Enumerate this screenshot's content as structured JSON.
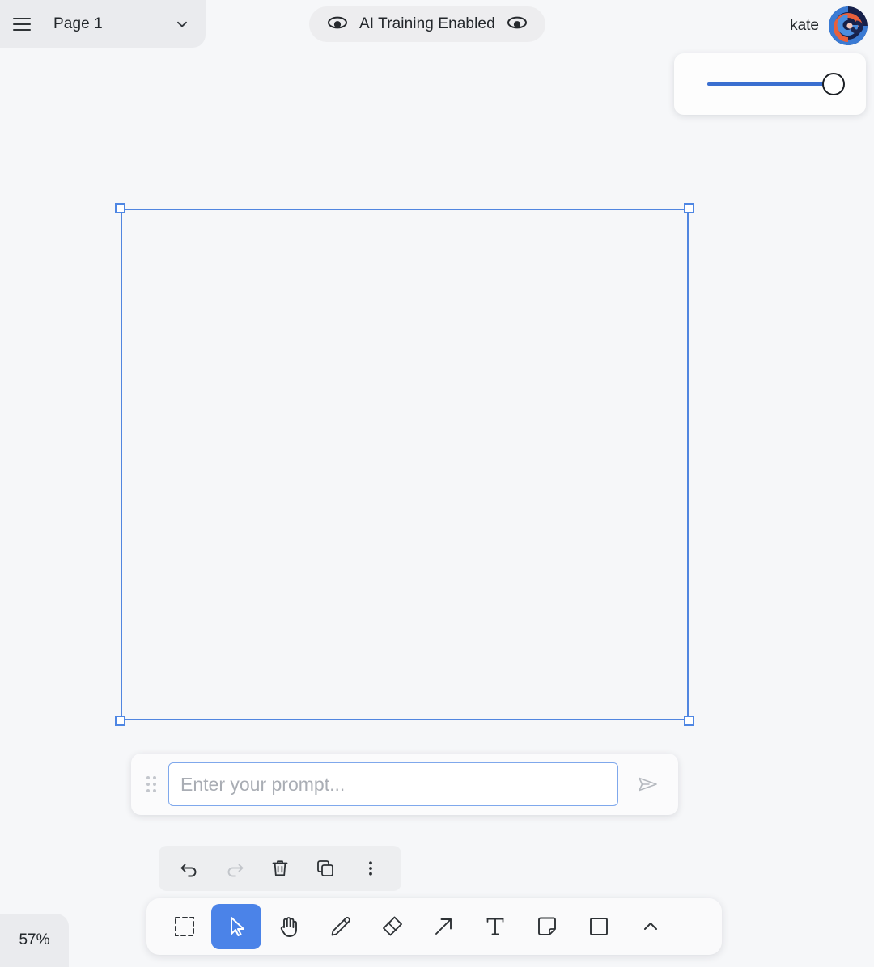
{
  "topbar": {
    "menu_icon": "hamburger-menu-icon",
    "page_label": "Page 1",
    "page_dropdown_icon": "chevron-down-icon"
  },
  "ai_pill": {
    "label": "AI Training Enabled",
    "left_icon": "eye-icon",
    "right_icon": "eye-icon"
  },
  "user": {
    "name": "kate",
    "avatar_icon": "avatar-swirl-icon",
    "avatar_colors": [
      "#1b2550",
      "#3b7bd4",
      "#e8603c",
      "#f3c8bd"
    ]
  },
  "slider": {
    "accent_color": "#3a6fd0",
    "thumb_border_color": "#1b1f24",
    "value_percent": 100
  },
  "selection": {
    "stroke_color": "#5186e0",
    "handle_fill": "#ffffff",
    "handles": [
      "top-left",
      "top-right",
      "bottom-left",
      "bottom-right"
    ]
  },
  "prompt": {
    "drag_handle_icon": "drag-dots-icon",
    "placeholder": "Enter your prompt...",
    "value": "",
    "send_icon": "send-paper-plane-icon",
    "border_color": "#7fa8ec"
  },
  "context_toolbar": {
    "buttons": [
      {
        "name": "undo",
        "icon": "undo-arrow-icon",
        "enabled": true
      },
      {
        "name": "redo",
        "icon": "redo-arrow-icon",
        "enabled": false
      },
      {
        "name": "delete",
        "icon": "trash-icon",
        "enabled": true
      },
      {
        "name": "duplicate",
        "icon": "duplicate-squares-icon",
        "enabled": true
      },
      {
        "name": "more",
        "icon": "more-vertical-dots-icon",
        "enabled": true
      }
    ]
  },
  "tool_dock": {
    "active_tool": "select-cursor",
    "active_color": "#4b83e8",
    "tools": [
      {
        "name": "marquee-select",
        "icon": "dashed-square-icon"
      },
      {
        "name": "select-cursor",
        "icon": "cursor-arrow-icon"
      },
      {
        "name": "pan-hand",
        "icon": "hand-icon"
      },
      {
        "name": "draw-pencil",
        "icon": "pencil-icon"
      },
      {
        "name": "eraser",
        "icon": "eraser-icon"
      },
      {
        "name": "arrow",
        "icon": "arrow-up-right-icon"
      },
      {
        "name": "text",
        "icon": "text-t-icon"
      },
      {
        "name": "sticky-note",
        "icon": "sticky-note-icon"
      },
      {
        "name": "rectangle",
        "icon": "square-icon"
      },
      {
        "name": "collapse",
        "icon": "chevron-up-icon"
      }
    ]
  },
  "zoom": {
    "value": "57%"
  }
}
